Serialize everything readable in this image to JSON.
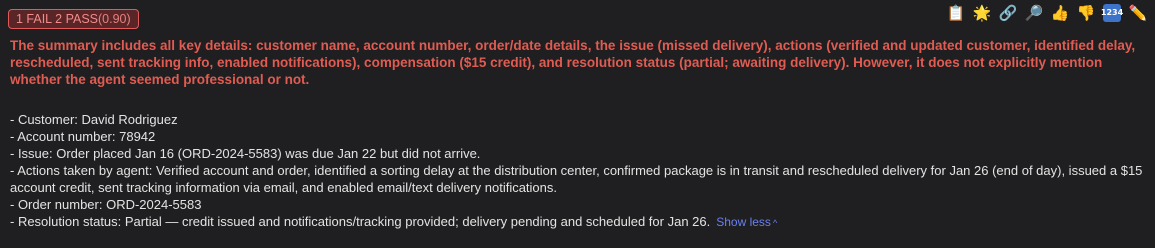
{
  "badge": {
    "label": "1 FAIL 2 PASS",
    "score": "(0.90)"
  },
  "toolbar": {
    "clipboard": "📋",
    "star": "🌟",
    "link": "🔗",
    "search": "🔎",
    "thumbs_up": "👍",
    "thumbs_down": "👎",
    "numbers": "1234",
    "pencil": "✏️"
  },
  "summary": "The summary includes all key details: customer name, account number, order/date details, the issue (missed delivery), actions (verified and updated customer, identified delay, rescheduled, sent tracking info, enabled notifications), compensation ($15 credit), and resolution status (partial; awaiting delivery). However, it does not explicitly mention whether the agent seemed professional or not.",
  "details": [
    "- Customer: David Rodriguez",
    "- Account number: 78942",
    "- Issue: Order placed Jan 16 (ORD-2024-5583) was due Jan 22 but did not arrive.",
    "- Actions taken by agent: Verified account and order, identified a sorting delay at the distribution center, confirmed package is in transit and rescheduled delivery for Jan 26 (end of day), issued a $15 account credit, sent tracking information via email, and enabled email/text delivery notifications.",
    "- Order number: ORD-2024-5583",
    "- Resolution status: Partial — credit issued and notifications/tracking provided; delivery pending and scheduled for Jan 26."
  ],
  "show_less": "Show less",
  "chevron": "^",
  "colors": {
    "background": "#1f1f21",
    "fail_text": "#e05c52",
    "badge_border": "#e05a5a",
    "link": "#6b7ff0"
  }
}
